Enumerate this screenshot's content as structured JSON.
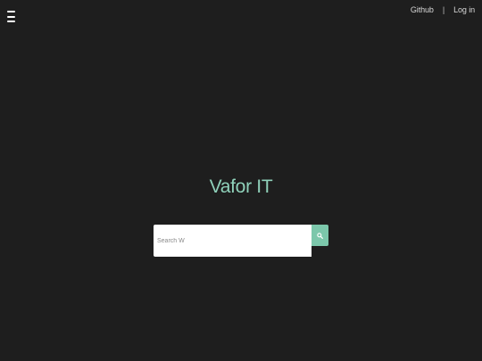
{
  "header": {
    "menu_icon": "hamburger-menu-icon",
    "links": {
      "github": "Github",
      "separator": "|",
      "login": "Log in"
    }
  },
  "main": {
    "title": "Vafor IT",
    "search": {
      "placeholder": "Search W",
      "value": "",
      "button_icon": "search-icon"
    }
  },
  "colors": {
    "background": "#1e1e1e",
    "accent": "#8fd1ba",
    "button": "#7cc7ab"
  }
}
